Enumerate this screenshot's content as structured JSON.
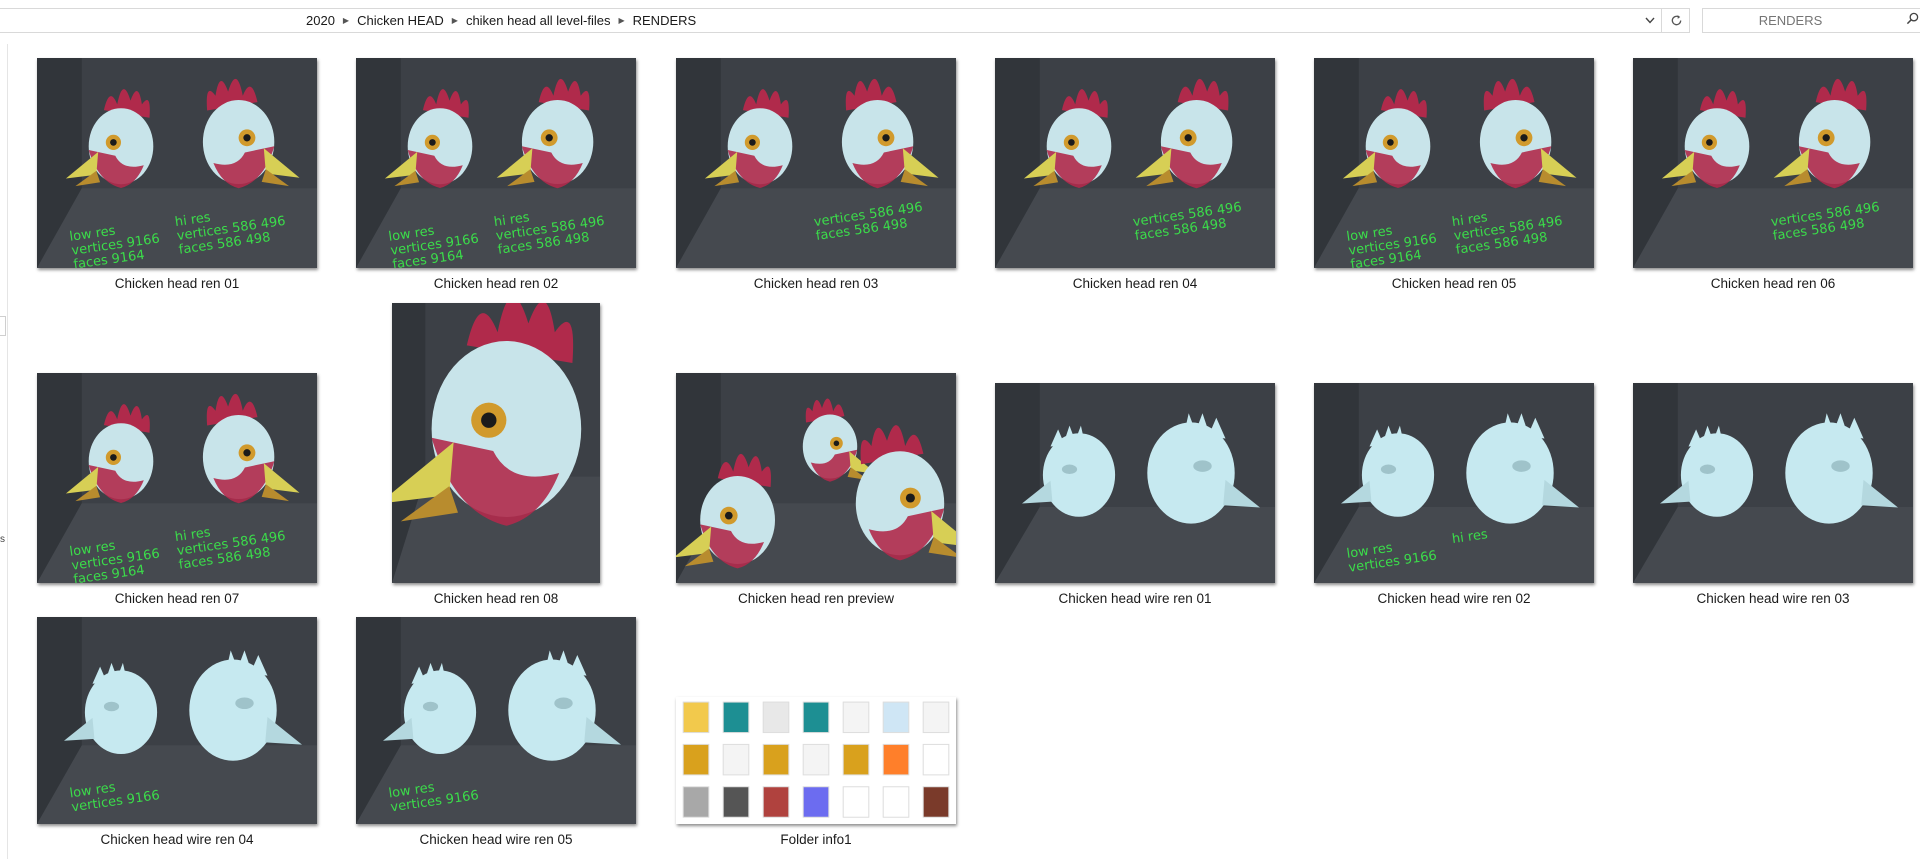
{
  "address_bar": {
    "crumbs": [
      "2020",
      "Chicken HEAD",
      "chiken head all level-files",
      "RENDERS"
    ]
  },
  "search": {
    "placeholder": "RENDERS"
  },
  "files": [
    {
      "name": "Chicken head ren 01",
      "thumb": "chicken-render",
      "overlay_left": [
        "low res",
        "vertices 9166",
        "faces 9164"
      ],
      "overlay_right": [
        "hi res",
        "vertices 586 496",
        "faces 586 498"
      ]
    },
    {
      "name": "Chicken head ren 02",
      "thumb": "chicken-render",
      "overlay_left": [
        "low res",
        "vertices 9166",
        "faces 9164"
      ],
      "overlay_right": [
        "hi res",
        "vertices 586 496",
        "faces 586 498"
      ]
    },
    {
      "name": "Chicken head ren 03",
      "thumb": "chicken-render",
      "overlay_left": [],
      "overlay_right": [
        "vertices 586 496",
        "faces 586 498"
      ]
    },
    {
      "name": "Chicken head ren 04",
      "thumb": "chicken-render",
      "overlay_left": [],
      "overlay_right": [
        "vertices 586 496",
        "faces 586 498"
      ]
    },
    {
      "name": "Chicken head ren 05",
      "thumb": "chicken-render",
      "overlay_left": [
        "low res",
        "vertices 9166",
        "faces 9164"
      ],
      "overlay_right": [
        "hi res",
        "vertices 586 496",
        "faces 586 498"
      ]
    },
    {
      "name": "Chicken head ren 06",
      "thumb": "chicken-render",
      "overlay_left": [],
      "overlay_right": [
        "vertices 586 496",
        "faces 586 498"
      ]
    },
    {
      "name": "Chicken head ren 07",
      "thumb": "chicken-render",
      "overlay_left": [
        "low res",
        "vertices 9166",
        "faces 9164"
      ],
      "overlay_right": [
        "hi res",
        "vertices 586 496",
        "faces 586 498"
      ]
    },
    {
      "name": "Chicken head ren 08",
      "thumb": "chicken-closeup",
      "overlay_left": [],
      "overlay_right": []
    },
    {
      "name": "Chicken head ren preview",
      "thumb": "chicken-group",
      "overlay_left": [],
      "overlay_right": []
    },
    {
      "name": "Chicken head wire ren 01",
      "thumb": "clay-render",
      "overlay_left": [],
      "overlay_right": []
    },
    {
      "name": "Chicken head wire ren 02",
      "thumb": "clay-render",
      "overlay_left": [
        "low res",
        "vertices 9166"
      ],
      "overlay_right": [
        "hi res"
      ]
    },
    {
      "name": "Chicken head wire ren 03",
      "thumb": "clay-render",
      "overlay_left": [],
      "overlay_right": []
    },
    {
      "name": "Chicken head wire ren 04",
      "thumb": "clay-render",
      "overlay_left": [
        "low res",
        "vertices 9166"
      ],
      "overlay_right": []
    },
    {
      "name": "Chicken head wire ren 05",
      "thumb": "clay-render",
      "overlay_left": [
        "low res",
        "vertices 9166"
      ],
      "overlay_right": []
    },
    {
      "name": "Folder info1",
      "thumb": "folder-contents",
      "overlay_left": [],
      "overlay_right": []
    }
  ],
  "colors": {
    "render_bg": "#3c4046",
    "comb": "#b02a4b",
    "face": "#c8e4ea",
    "beak": "#d7cf55",
    "clay": "#c6e9f0",
    "overlay_text": "#3bdc4a"
  },
  "icons": {
    "breadcrumb_separator": "chevron-right-icon",
    "history_dropdown": "chevron-down-icon",
    "refresh": "refresh-icon",
    "search": "search-icon"
  }
}
